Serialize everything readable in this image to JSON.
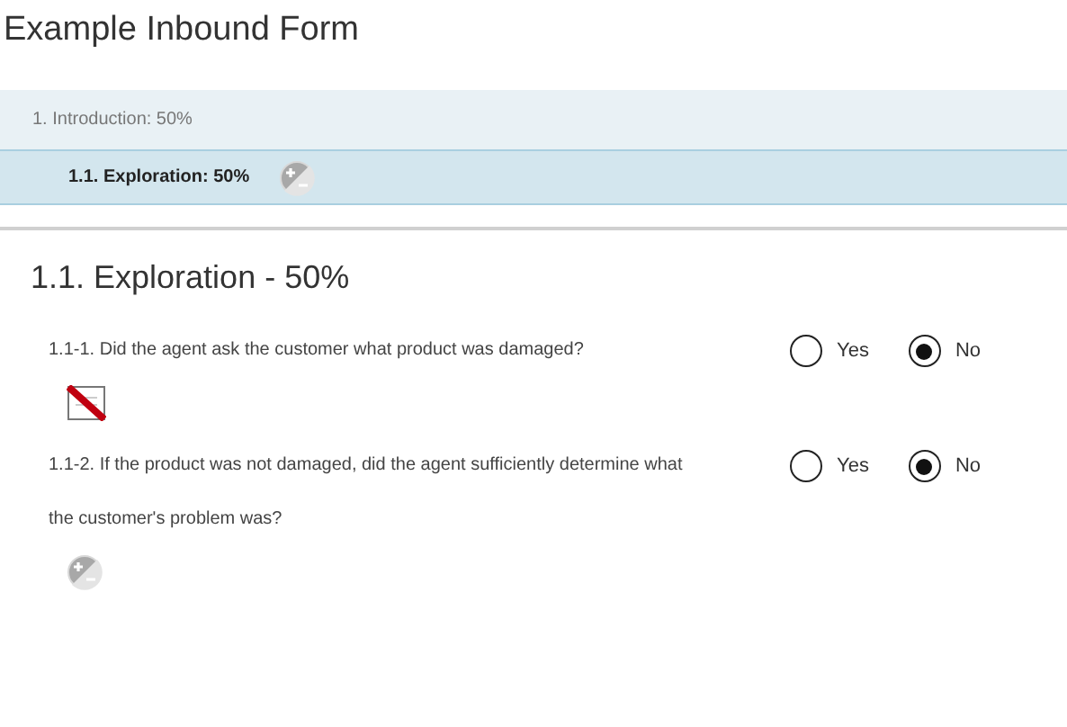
{
  "form_title": "Example Inbound Form",
  "sections": [
    {
      "label": "1. Introduction: 50%",
      "selected": false,
      "kind": "plain"
    },
    {
      "label": "1.1. Exploration: 50%",
      "selected": true,
      "kind": "toggle"
    }
  ],
  "heading": "1.1. Exploration - 50%",
  "questions": [
    {
      "text": "1.1-1. Did the agent ask the customer what product was damaged?",
      "kind": "crossed",
      "options": [
        {
          "label": "Yes",
          "selected": false
        },
        {
          "label": "No",
          "selected": true
        }
      ]
    },
    {
      "text": "1.1-2. If the product was not damaged, did the agent sufficiently determine what the customer's problem was?",
      "kind": "toggle",
      "options": [
        {
          "label": "Yes",
          "selected": false
        },
        {
          "label": "No",
          "selected": true
        }
      ]
    }
  ]
}
